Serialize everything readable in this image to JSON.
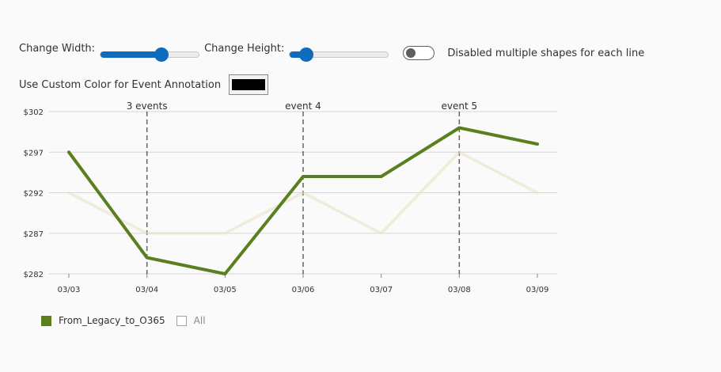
{
  "controls": {
    "width_label": "Change Width:",
    "width_value": 0.62,
    "height_label": "Change Height:",
    "height_value": 0.17,
    "toggle_label": "Disabled multiple shapes for each line",
    "toggle_on": false,
    "color_label": "Use Custom Color for Event Annotation",
    "color_value": "#000000"
  },
  "chart_data": {
    "type": "line",
    "x": [
      "03/03",
      "03/04",
      "03/05",
      "03/06",
      "03/07",
      "03/08",
      "03/09"
    ],
    "series": [
      {
        "name": "From_Legacy_to_O365",
        "color": "#5a7f1e",
        "values": [
          297,
          284,
          282,
          294,
          294,
          300,
          298
        ]
      },
      {
        "name": "All",
        "color": "#e8dfc0",
        "values": [
          292,
          287,
          287,
          292,
          287,
          297,
          292
        ]
      }
    ],
    "y_ticks": [
      "$302",
      "$297",
      "$292",
      "$287",
      "$282"
    ],
    "y_tick_values": [
      302,
      297,
      292,
      287,
      282
    ],
    "ylim": [
      282,
      302
    ],
    "grid": true,
    "legend_position": "bottom-left",
    "events": [
      {
        "label": "3 events",
        "x": "03/04"
      },
      {
        "label": "event 4",
        "x": "03/06"
      },
      {
        "label": "event 5",
        "x": "03/08"
      }
    ]
  }
}
